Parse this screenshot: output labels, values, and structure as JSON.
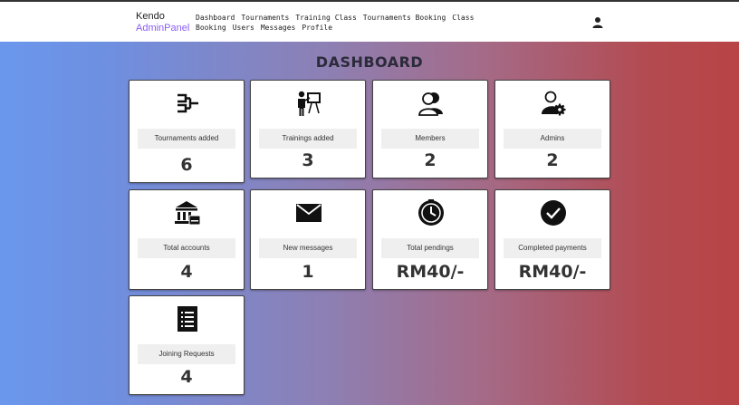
{
  "brand": {
    "line1": "Kendo",
    "line2": "AdminPanel"
  },
  "nav": {
    "items": [
      "Dashboard",
      "Tournaments",
      "Training Class",
      "Tournaments Booking",
      "Class Booking",
      "Users",
      "Messages",
      "Profile"
    ]
  },
  "user_icon": "user-icon",
  "page": {
    "title": "DASHBOARD"
  },
  "cards": [
    {
      "label": "Tournaments added",
      "value": "6",
      "icon": "tournament-bracket-icon"
    },
    {
      "label": "Trainings added",
      "value": "3",
      "icon": "teacher-board-icon"
    },
    {
      "label": "Members",
      "value": "2",
      "icon": "members-icon"
    },
    {
      "label": "Admins",
      "value": "2",
      "icon": "admin-gear-icon"
    },
    {
      "label": "Total accounts",
      "value": "4",
      "icon": "bank-icon"
    },
    {
      "label": "New messages",
      "value": "1",
      "icon": "envelope-icon"
    },
    {
      "label": "Total pendings",
      "value": "RM40/-",
      "icon": "clock-icon"
    },
    {
      "label": "Completed payments",
      "value": "RM40/-",
      "icon": "check-circle-icon"
    },
    {
      "label": "Joining Requests",
      "value": "4",
      "icon": "document-list-icon"
    }
  ],
  "colors": {
    "gradient_left": "#6a97ec",
    "gradient_right": "#b84446",
    "brand_accent": "#8a5cf6"
  }
}
